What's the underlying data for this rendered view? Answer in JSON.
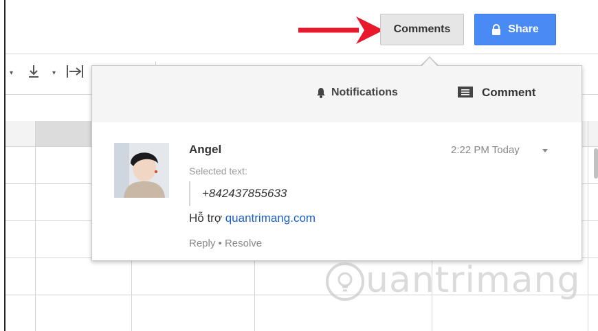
{
  "header": {
    "comments_label": "Comments",
    "share_label": "Share",
    "arrow_color": "#e8192c",
    "share_color": "#4a8af4"
  },
  "popup": {
    "notifications_label": "Notifications",
    "comment_label": "Comment",
    "comment": {
      "author": "Angel",
      "time": "2:22 PM Today",
      "selected_label": "Selected text:",
      "selected_text": "+842437855633",
      "body_prefix": "Hỗ trợ ",
      "body_link": "quantrimang.com",
      "reply_label": "Reply",
      "separator": " • ",
      "resolve_label": "Resolve"
    }
  },
  "watermark": {
    "logo_text": "uantrimang"
  },
  "icons": [
    "bell-icon",
    "comment-icon",
    "lock-icon",
    "vertical-align-bottom-icon",
    "text-wrap-icon",
    "dropdown-caret-icon"
  ]
}
